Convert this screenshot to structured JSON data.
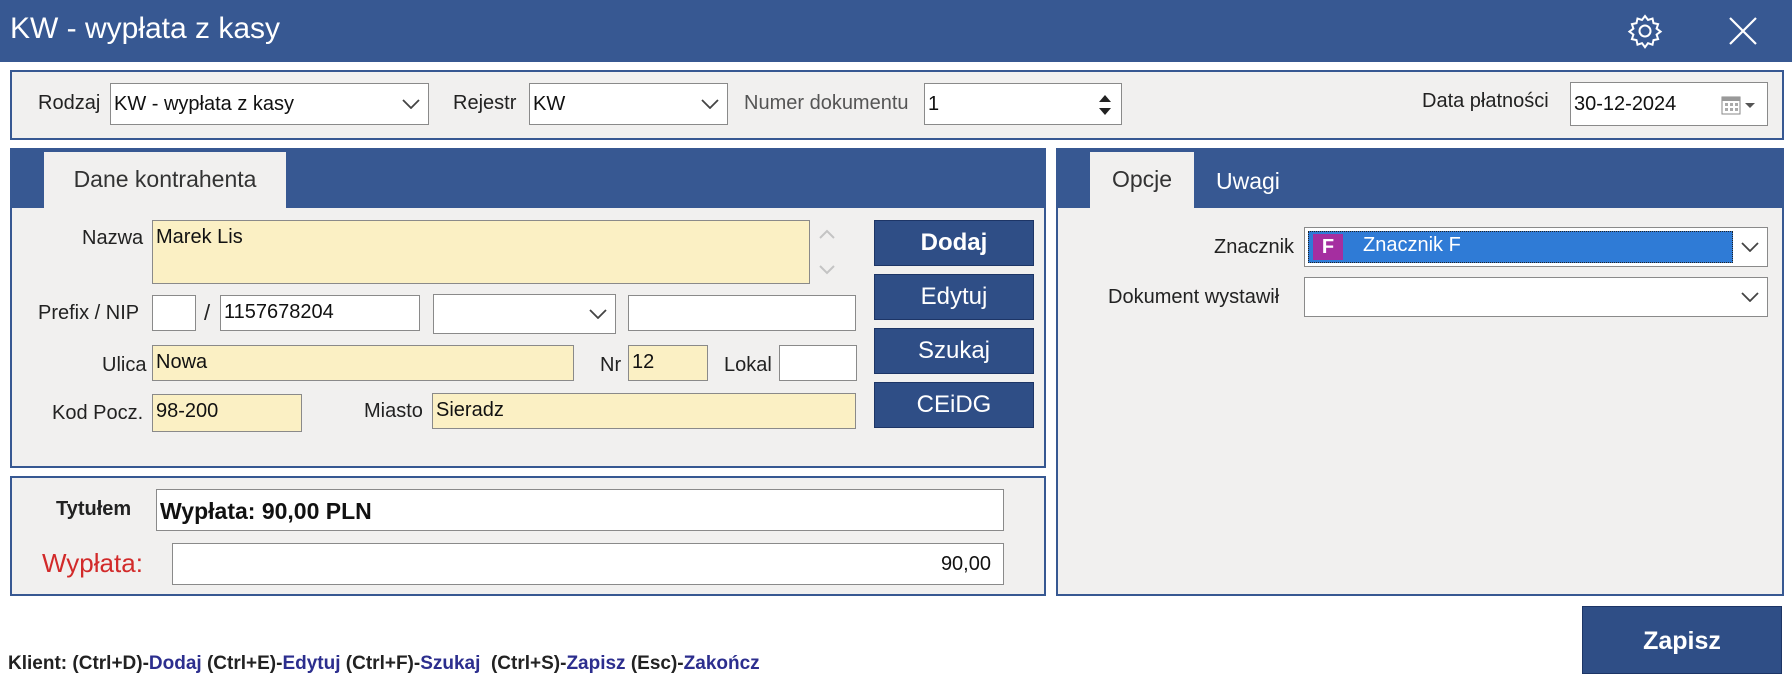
{
  "window": {
    "title": "KW - wypłata z kasy"
  },
  "icons": {
    "settings": "gear-icon",
    "close": "close-icon",
    "calendar": "calendar-icon",
    "badge": "znacznik-badge-icon"
  },
  "colors": {
    "brand": "#375892",
    "button": "#2f4e86",
    "required_bg": "#fbf0c4",
    "alert_red": "#d22a2a",
    "select_blue": "#2f7bd6",
    "badge_purple": "#a52ea0"
  },
  "top": {
    "rodzaj_label": "Rodzaj",
    "rodzaj_value": "KW - wypłata z kasy",
    "rejestr_label": "Rejestr",
    "rejestr_value": "KW",
    "numer_label": "Numer dokumentu",
    "numer_value": "1",
    "data_label": "Data płatności",
    "data_value": "30-12-2024"
  },
  "contractor": {
    "tab": "Dane kontrahenta",
    "nazwa_label": "Nazwa",
    "nazwa_value": "Marek Lis",
    "prefix_label": "Prefix / NIP",
    "prefix_value": "",
    "slash": "/",
    "nip_value": "1157678204",
    "nip_type_value": "",
    "extra_value": "",
    "ulica_label": "Ulica",
    "ulica_value": "Nowa",
    "nr_label": "Nr",
    "nr_value": "12",
    "lokal_label": "Lokal",
    "lokal_value": "",
    "kod_label": "Kod Pocz.",
    "kod_value": "98-200",
    "miasto_label": "Miasto",
    "miasto_value": "Sieradz"
  },
  "buttons": {
    "dodaj": "Dodaj",
    "edytuj": "Edytuj",
    "szukaj": "Szukaj",
    "ceidg": "CEiDG",
    "zapisz": "Zapisz"
  },
  "payment": {
    "tytul_label": "Tytułem",
    "tytul_value": "Wypłata: 90,00 PLN",
    "wyplata_label": "Wypłata:",
    "wyplata_value": "90,00"
  },
  "right": {
    "tab_opcje": "Opcje",
    "tab_uwagi": "Uwagi",
    "znacznik_label": "Znacznik",
    "znacznik_badge": "F",
    "znacznik_value": "Znacznik F",
    "wystawil_label": "Dokument wystawił",
    "wystawil_value": ""
  },
  "shortcuts": {
    "klient": "Klient: ",
    "k1": "(Ctrl+D)-",
    "v1": "Dodaj",
    "k2": " (Ctrl+E)-",
    "v2": "Edytuj",
    "k3": " (Ctrl+F)-",
    "v3": "Szukaj",
    "k4": "  (Ctrl+S)-",
    "v4": "Zapisz",
    "k5": " (Esc)-",
    "v5": "Zakończ"
  }
}
